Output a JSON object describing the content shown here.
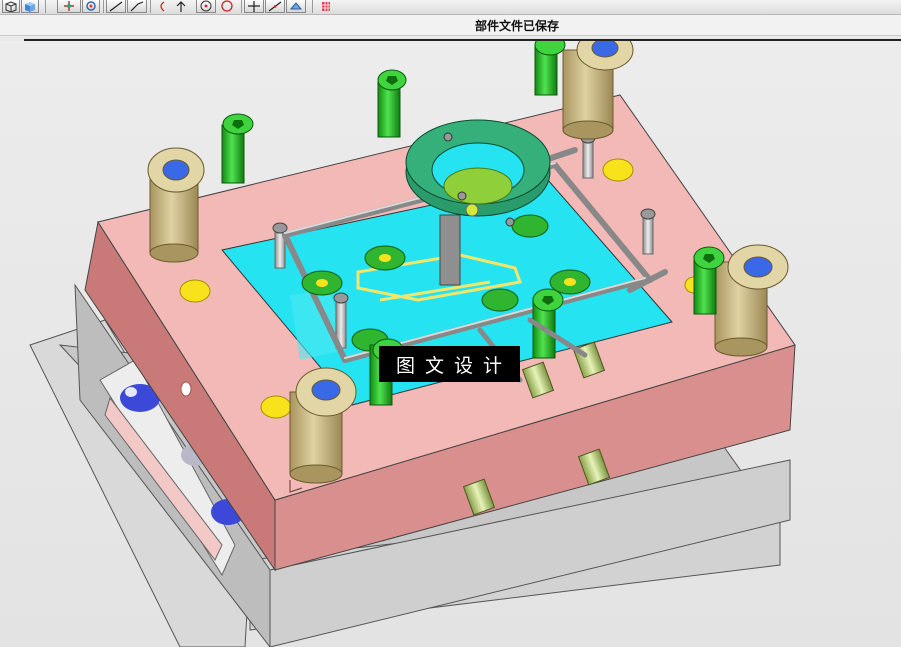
{
  "toolbar": {
    "buttons": [
      {
        "id": "view-cube-wire",
        "icon": "cube-wire-icon"
      },
      {
        "id": "view-cube-solid",
        "icon": "cube-solid-icon"
      },
      {
        "id": "pan-view",
        "icon": "pan-arrows-icon"
      },
      {
        "id": "rotate-view",
        "icon": "rotate-icon"
      },
      {
        "id": "line-tool",
        "icon": "line-icon"
      },
      {
        "id": "polyline-tool",
        "icon": "polyline-icon"
      },
      {
        "id": "arc-tool",
        "icon": "arc-icon"
      },
      {
        "id": "pick-point",
        "icon": "pick-icon"
      },
      {
        "id": "circle-center",
        "icon": "circle-point-icon"
      },
      {
        "id": "circle-tool",
        "icon": "circle-icon"
      },
      {
        "id": "axis-tool",
        "icon": "cross-axis-icon"
      },
      {
        "id": "spline-tool",
        "icon": "spline-icon"
      },
      {
        "id": "view-orient",
        "icon": "view-orient-icon"
      },
      {
        "id": "grid-tool",
        "icon": "grid-icon"
      }
    ]
  },
  "status": {
    "message": "部件文件已保存"
  },
  "viewport": {
    "watermark": "图文设计",
    "colors": {
      "clamp_plate": "#f2b9b7",
      "clamp_plate_side": "#c97a78",
      "cavity": "#25e3f0",
      "base_gray": "#cfcfcf",
      "guide_bush": "#c9b98a",
      "bolt_green": "#28c428",
      "locate_ring": "#2a9b6a",
      "yellow_marker": "#f7e21b"
    }
  }
}
